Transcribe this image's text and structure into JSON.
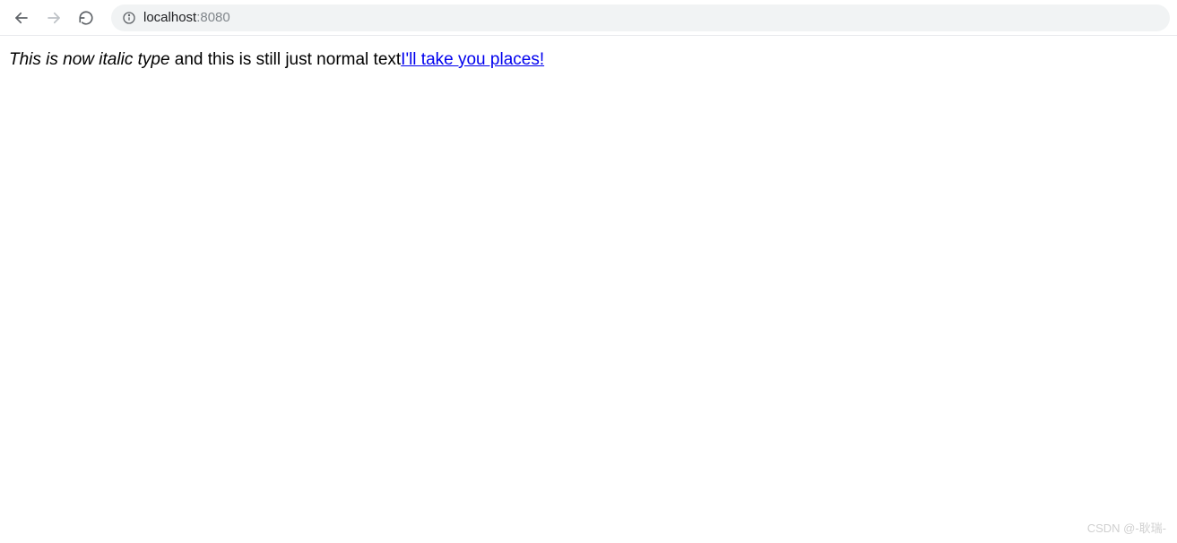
{
  "toolbar": {
    "url_host": "localhost",
    "url_port": ":8080"
  },
  "content": {
    "italic_text": "This is now italic type",
    "normal_text": " and this is still just normal text",
    "link_text": "I'll take you places!"
  },
  "watermark": "CSDN @-耿瑞-"
}
